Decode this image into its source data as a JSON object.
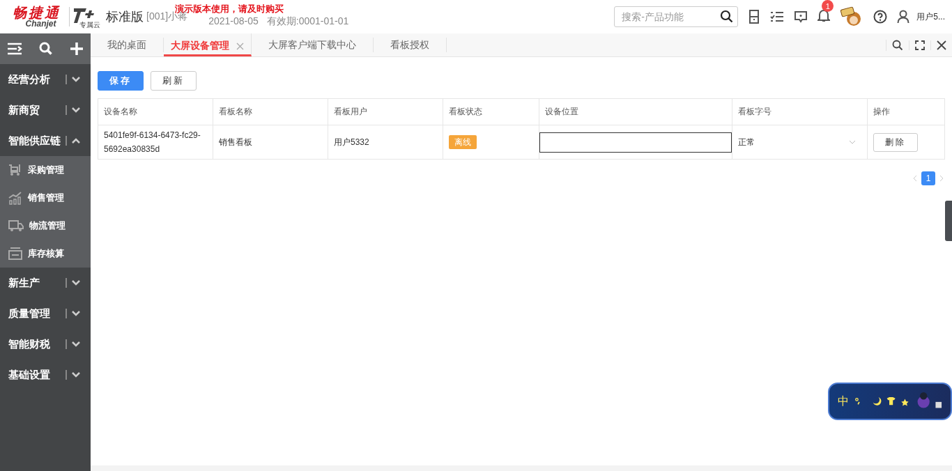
{
  "header": {
    "brand": "畅捷通",
    "brand_sub": "Chanjet",
    "product": "标准版",
    "product_badge": "专属云",
    "account": "[001]小蒋",
    "date": "2021-08-05",
    "validity": "有效期:0001-01-01",
    "notice": "演示版本使用，请及时购买",
    "search": {
      "placeholder": "搜索-产品功能"
    },
    "notification_count": "1",
    "user": "用户5..."
  },
  "sidebar": {
    "groups": [
      {
        "label": "经营分析",
        "expanded": false
      },
      {
        "label": "新商贸",
        "expanded": false
      },
      {
        "label": "智能供应链",
        "expanded": true,
        "children": [
          {
            "label": "采购管理",
            "kind": "cart"
          },
          {
            "label": "销售管理",
            "kind": "chart"
          },
          {
            "label": "物流管理",
            "kind": "truck"
          },
          {
            "label": "库存核算",
            "kind": "printer"
          }
        ]
      },
      {
        "label": "新生产",
        "expanded": false
      },
      {
        "label": "质量管理",
        "expanded": false
      },
      {
        "label": "智能财税",
        "expanded": false
      },
      {
        "label": "基础设置",
        "expanded": false
      }
    ]
  },
  "tabs": [
    {
      "label": "我的桌面",
      "selected": false,
      "closable": false
    },
    {
      "label": "大屏设备管理",
      "selected": true,
      "closable": true
    },
    {
      "label": "大屏客户端下载中心",
      "selected": false,
      "closable": false
    },
    {
      "label": "看板授权",
      "selected": false,
      "closable": false
    }
  ],
  "buttons": [
    {
      "label": "保存",
      "primary": true
    },
    {
      "label": "刷新",
      "primary": false
    }
  ],
  "table": {
    "columns": [
      "设备名称",
      "看板名称",
      "看板用户",
      "看板状态",
      "设备位置",
      "看板字号",
      "操作"
    ],
    "rows": [
      {
        "device": "5401fe9f-6134-6473-fc29-5692ea30835d",
        "board": "销售看板",
        "user": "用户5332",
        "status": "离线",
        "location": "",
        "font_size": "正常",
        "action": "删除"
      }
    ]
  },
  "pagination": {
    "pages": [
      {
        "label": "1",
        "selected": true
      }
    ]
  },
  "ime": {
    "label": "中"
  }
}
